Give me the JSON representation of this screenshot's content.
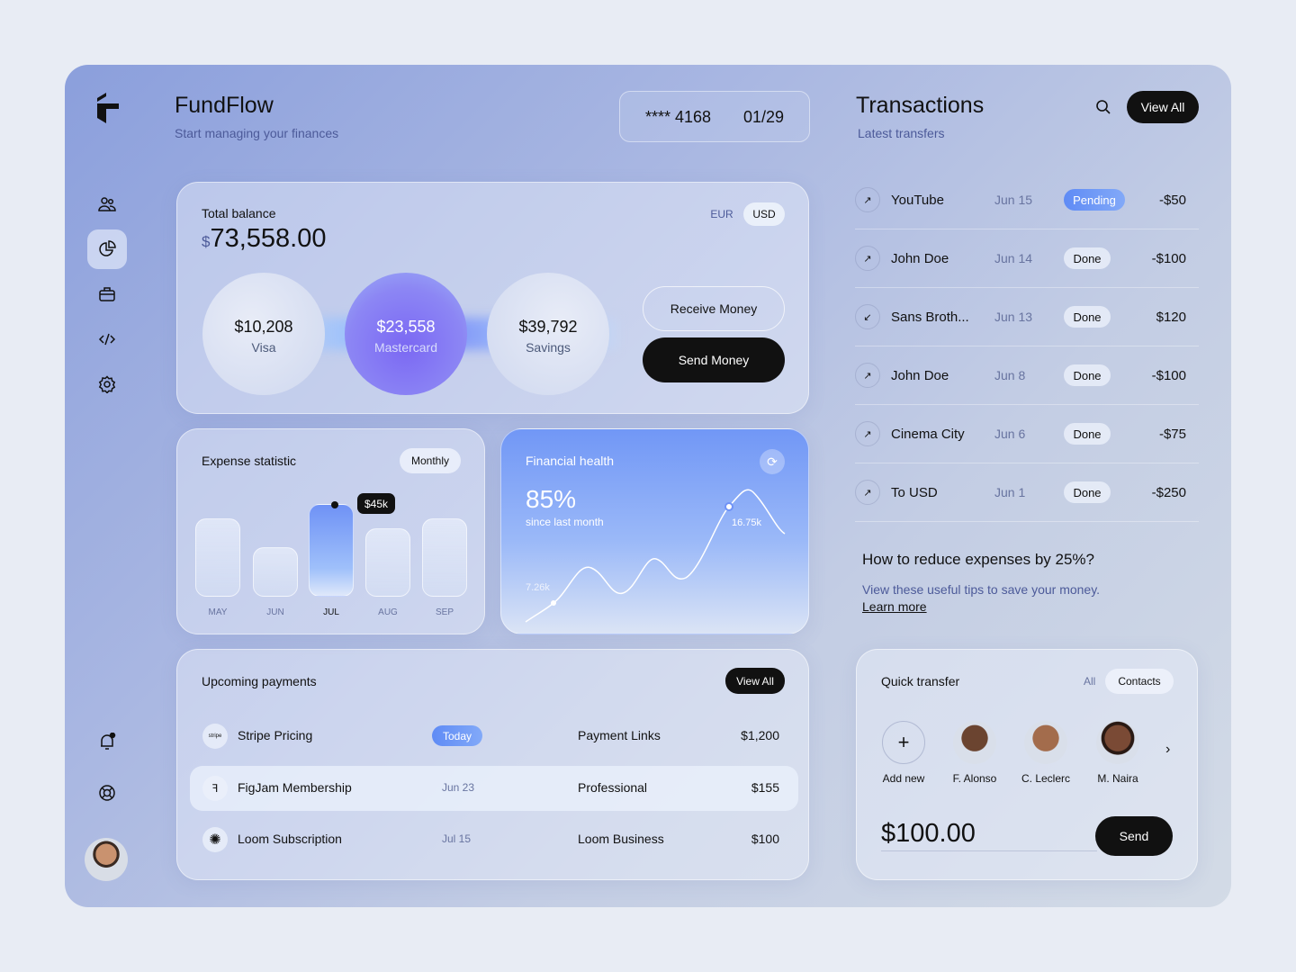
{
  "app": {
    "title": "FundFlow",
    "subtitle": "Start managing your finances"
  },
  "card_chip": {
    "number": "**** 4168",
    "expiry": "01/29"
  },
  "sidebar": {
    "items": [
      {
        "icon": "users-icon"
      },
      {
        "icon": "pie-chart-icon",
        "active": true
      },
      {
        "icon": "briefcase-icon"
      },
      {
        "icon": "code-icon"
      },
      {
        "icon": "gear-icon"
      }
    ],
    "bottom": [
      {
        "icon": "bell-icon"
      },
      {
        "icon": "help-icon"
      }
    ]
  },
  "balance": {
    "label": "Total balance",
    "currency_symbol": "$",
    "amount": "73,558.00",
    "currencies": [
      "EUR",
      "USD"
    ],
    "selected_currency": "USD",
    "accounts": [
      {
        "amount": "$10,208",
        "name": "Visa"
      },
      {
        "amount": "$23,558",
        "name": "Mastercard"
      },
      {
        "amount": "$39,792",
        "name": "Savings"
      }
    ],
    "receive_label": "Receive Money",
    "send_label": "Send Money"
  },
  "expense": {
    "title": "Expense statistic",
    "period": "Monthly",
    "tooltip": "$45k",
    "highlight": "JUL",
    "months": [
      {
        "label": "MAY",
        "value": 38
      },
      {
        "label": "JUN",
        "value": 24
      },
      {
        "label": "JUL",
        "value": 45
      },
      {
        "label": "AUG",
        "value": 33
      },
      {
        "label": "SEP",
        "value": 38
      }
    ]
  },
  "health": {
    "title": "Financial health",
    "percent": "85%",
    "caption": "since last month",
    "low_label": "7.26k",
    "high_label": "16.75k",
    "accent": "#6f92f6"
  },
  "upcoming": {
    "title": "Upcoming payments",
    "view_all": "View All",
    "rows": [
      {
        "icon": "stripe",
        "name": "Stripe Pricing",
        "date": "Today",
        "plan": "Payment Links",
        "amount": "$1,200",
        "today": true
      },
      {
        "icon": "figma",
        "name": "FigJam Membership",
        "date": "Jun 23",
        "plan": "Professional",
        "amount": "$155"
      },
      {
        "icon": "loom",
        "name": "Loom Subscription",
        "date": "Jul 15",
        "plan": "Loom Business",
        "amount": "$100"
      }
    ]
  },
  "transactions": {
    "title": "Transactions",
    "subtitle": "Latest transfers",
    "view_all": "View All",
    "rows": [
      {
        "dir": "out",
        "name": "YouTube",
        "date": "Jun 15",
        "status": "Pending",
        "amount": "-$50"
      },
      {
        "dir": "out",
        "name": "John Doe",
        "date": "Jun 14",
        "status": "Done",
        "amount": "-$100"
      },
      {
        "dir": "in",
        "name": "Sans Broth...",
        "date": "Jun 13",
        "status": "Done",
        "amount": "$120"
      },
      {
        "dir": "out",
        "name": "John Doe",
        "date": "Jun 8",
        "status": "Done",
        "amount": "-$100"
      },
      {
        "dir": "out",
        "name": "Cinema City",
        "date": "Jun 6",
        "status": "Done",
        "amount": "-$75"
      },
      {
        "dir": "out",
        "name": "To USD",
        "date": "Jun 1",
        "status": "Done",
        "amount": "-$250"
      }
    ]
  },
  "tips": {
    "title": "How to reduce expenses by 25%?",
    "text": "View these useful tips to save your money.",
    "link": "Learn more"
  },
  "quick": {
    "title": "Quick transfer",
    "filters": [
      "All",
      "Contacts"
    ],
    "add_label": "Add new",
    "contacts": [
      "F. Alonso",
      "C. Leclerc",
      "M. Naira"
    ],
    "amount": "$100.00",
    "send_label": "Send"
  }
}
